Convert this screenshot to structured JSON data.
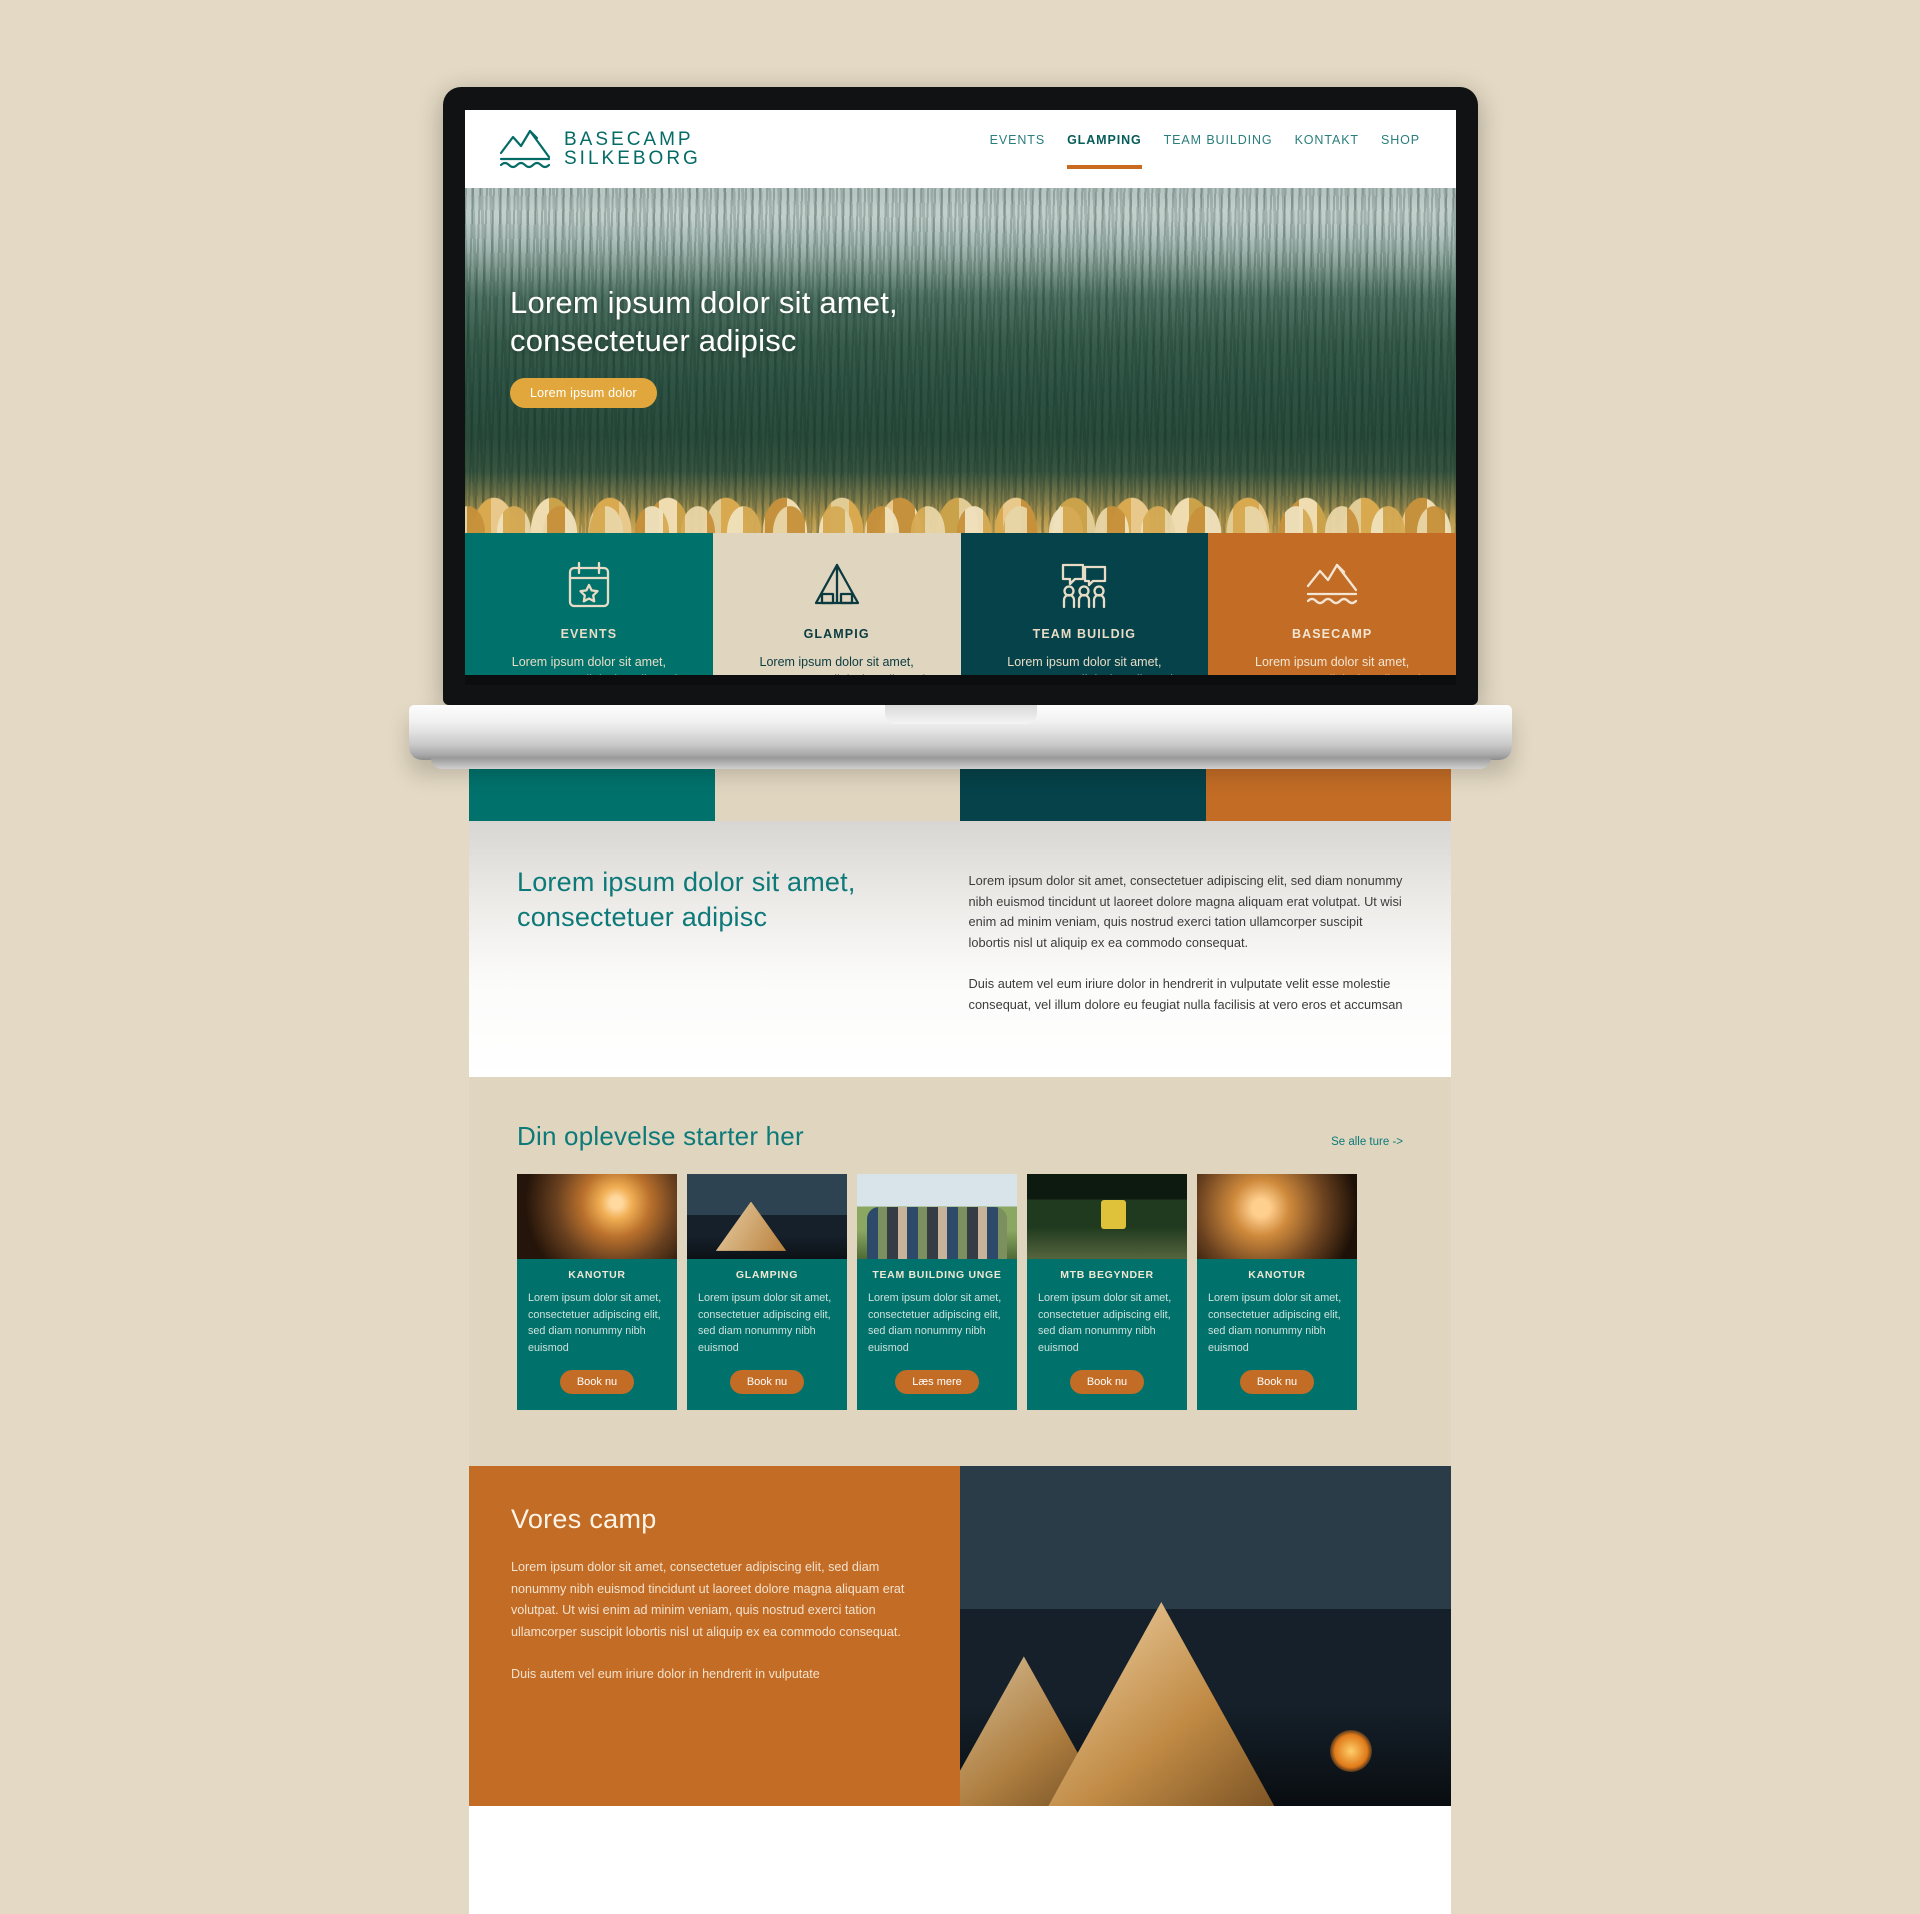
{
  "brand": {
    "line1": "BASECAMP",
    "line2": "SILKEBORG",
    "logo_icon": "mountain-waves-logo-icon"
  },
  "nav": {
    "items": [
      {
        "label": "EVENTS",
        "active": false
      },
      {
        "label": "GLAMPING",
        "active": true
      },
      {
        "label": "TEAM BUILDING",
        "active": false
      },
      {
        "label": "KONTAKT",
        "active": false
      },
      {
        "label": "SHOP",
        "active": false
      }
    ],
    "active_indicator_color": "#c86a21"
  },
  "hero": {
    "title_line1": "Lorem ipsum dolor sit amet,",
    "title_line2": "consectetuer adipisc",
    "cta_label": "Lorem ipsum dolor",
    "cta_color": "#e2a73c"
  },
  "tiles": [
    {
      "title": "EVENTS",
      "desc": "Lorem ipsum dolor sit amet, consectetuer adipiscing elit, sed diam nonummy nibh euismod",
      "icon": "calendar-star-icon",
      "bg": "#00726b"
    },
    {
      "title": "GLAMPIG",
      "desc": "Lorem ipsum dolor sit amet, consectetuer adipiscing elit, sed diam nonummy nibh euismod",
      "icon": "tent-icon",
      "bg": "#e0d6c0"
    },
    {
      "title": "TEAM BUILDIG",
      "desc": "Lorem ipsum dolor sit amet, consectetuer adipiscing elit, sed diam nonummy nibh euismod",
      "icon": "team-speech-icon",
      "bg": "#064249"
    },
    {
      "title": "BASECAMP",
      "desc": "Lorem ipsum dolor sit amet, consectetuer adipiscing elit, sed diam nonummy nibh euismod",
      "icon": "mountain-waves-icon",
      "bg": "#c26c26"
    }
  ],
  "intro": {
    "heading": "Lorem ipsum dolor sit amet, consectetuer adipisc",
    "paragraph1": "Lorem ipsum dolor sit amet, consectetuer adipiscing elit, sed diam nonummy nibh euismod tincidunt ut laoreet dolore magna aliquam erat volutpat. Ut wisi enim ad minim veniam, quis nostrud exerci tation ullamcorper suscipit lobortis nisl ut aliquip ex ea commodo consequat.",
    "paragraph2": "Duis autem vel eum iriure dolor in hendrerit in vulputate velit esse molestie consequat, vel illum dolore eu feugiat nulla facilisis at vero eros et accumsan",
    "heading_color": "#0d7a79"
  },
  "experiences": {
    "title": "Din oplevelse starter her",
    "see_all_label": "Se alle ture ->",
    "cards": [
      {
        "title": "KANOTUR",
        "desc": "Lorem ipsum dolor sit amet, consectetuer adipiscing elit, sed diam nonummy nibh euismod",
        "button": "Book nu",
        "photo": "canoe-sunrise-photo"
      },
      {
        "title": "GLAMPING",
        "desc": "Lorem ipsum dolor sit amet, consectetuer adipiscing elit, sed diam nonummy nibh euismod",
        "button": "Book nu",
        "photo": "glamping-tents-photo"
      },
      {
        "title": "TEAM BUILDING UNGE",
        "desc": "Lorem ipsum dolor sit amet, consectetuer adipiscing elit, sed diam nonummy nibh euismod",
        "button": "Læs mere",
        "photo": "youth-group-photo"
      },
      {
        "title": "MTB BEGYNDER",
        "desc": "Lorem ipsum dolor sit amet, consectetuer adipiscing elit, sed diam nonummy nibh euismod",
        "button": "Book nu",
        "photo": "mountain-biker-photo"
      },
      {
        "title": "KANOTUR",
        "desc": "Lorem ipsum dolor sit amet, consectetuer adipiscing elit, sed diam nonummy nibh euismod",
        "button": "Book nu",
        "photo": "canoe-mist-photo"
      }
    ]
  },
  "camp": {
    "title": "Vores camp",
    "paragraph1": "Lorem ipsum dolor sit amet, consectetuer adipiscing elit, sed diam nonummy nibh euismod tincidunt ut laoreet dolore magna aliquam erat volutpat. Ut wisi enim ad minim veniam, quis nostrud exerci tation ullamcorper suscipit lobortis nisl ut aliquip ex ea commodo consequat.",
    "paragraph2": "Duis autem vel eum iriure dolor in hendrerit in vulputate",
    "bg": "#c26c26",
    "photo": "night-glamping-tents-photo"
  },
  "palette": {
    "background": "#e3d9c4",
    "teal": "#00726b",
    "dark_teal": "#064249",
    "orange": "#c26c26",
    "sand": "#e0d6c0",
    "heading_teal": "#0d7a79"
  }
}
